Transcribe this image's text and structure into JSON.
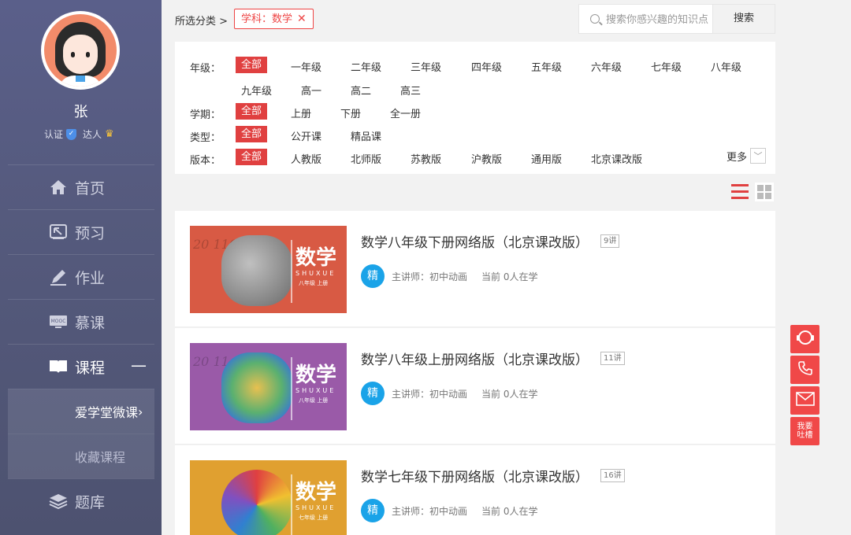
{
  "user": {
    "name": "张",
    "verified_label": "认证",
    "expert_label": "达人"
  },
  "sidebar": {
    "items": [
      {
        "label": "首页",
        "icon": "home-icon"
      },
      {
        "label": "预习",
        "icon": "preview-icon"
      },
      {
        "label": "作业",
        "icon": "pencil-icon"
      },
      {
        "label": "慕课",
        "icon": "mooc-icon"
      },
      {
        "label": "课程",
        "icon": "book-icon",
        "expanded_mark": "—"
      },
      {
        "label": "题库",
        "icon": "layers-icon"
      }
    ],
    "subitems": [
      {
        "label": "爱学堂微课",
        "arrow": "›"
      },
      {
        "label": "收藏课程"
      }
    ]
  },
  "breadcrumb": {
    "label": "所选分类 >",
    "chip": "学科：数学"
  },
  "search": {
    "placeholder": "搜索你感兴趣的知识点",
    "button": "搜索"
  },
  "filters": {
    "grade": {
      "label": "年级：",
      "options": [
        "全部",
        "一年级",
        "二年级",
        "三年级",
        "四年级",
        "五年级",
        "六年级",
        "七年级",
        "八年级",
        "九年级",
        "高一",
        "高二",
        "高三"
      ]
    },
    "term": {
      "label": "学期：",
      "options": [
        "全部",
        "上册",
        "下册",
        "全一册"
      ]
    },
    "type": {
      "label": "类型：",
      "options": [
        "全部",
        "公开课",
        "精品课"
      ]
    },
    "edition": {
      "label": "版本：",
      "options": [
        "全部",
        "人教版",
        "北师版",
        "苏教版",
        "沪教版",
        "通用版",
        "北京课改版"
      ]
    },
    "more": "更多"
  },
  "courses": [
    {
      "title": "数学八年级下册网络版（北京课改版）",
      "count": "9讲",
      "badge": "精",
      "teacher": "主讲师：初中动画",
      "learning": "当前 0人在学",
      "cover_title": "数学",
      "cover_pinyin": "SHUXUE",
      "cover_grade": "八年级 上册",
      "color": "#d85a44",
      "blob": "#8a8a8a"
    },
    {
      "title": "数学八年级上册网络版（北京课改版）",
      "count": "11讲",
      "badge": "精",
      "teacher": "主讲师：初中动画",
      "learning": "当前 0人在学",
      "cover_title": "数学",
      "cover_pinyin": "SHUXUE",
      "cover_grade": "八年级 上册",
      "color": "#9a5aa8",
      "blob": "#c8a040"
    },
    {
      "title": "数学七年级下册网络版（北京课改版）",
      "count": "16讲",
      "badge": "精",
      "teacher": "主讲师：初中动画",
      "learning": "当前 0人在学",
      "cover_title": "数学",
      "cover_pinyin": "SHUXUE",
      "cover_grade": "七年级 上册",
      "color": "#e0a030",
      "blob": "#6a5ab8"
    }
  ],
  "float_actions": {
    "feedback": "我要吐槽"
  }
}
